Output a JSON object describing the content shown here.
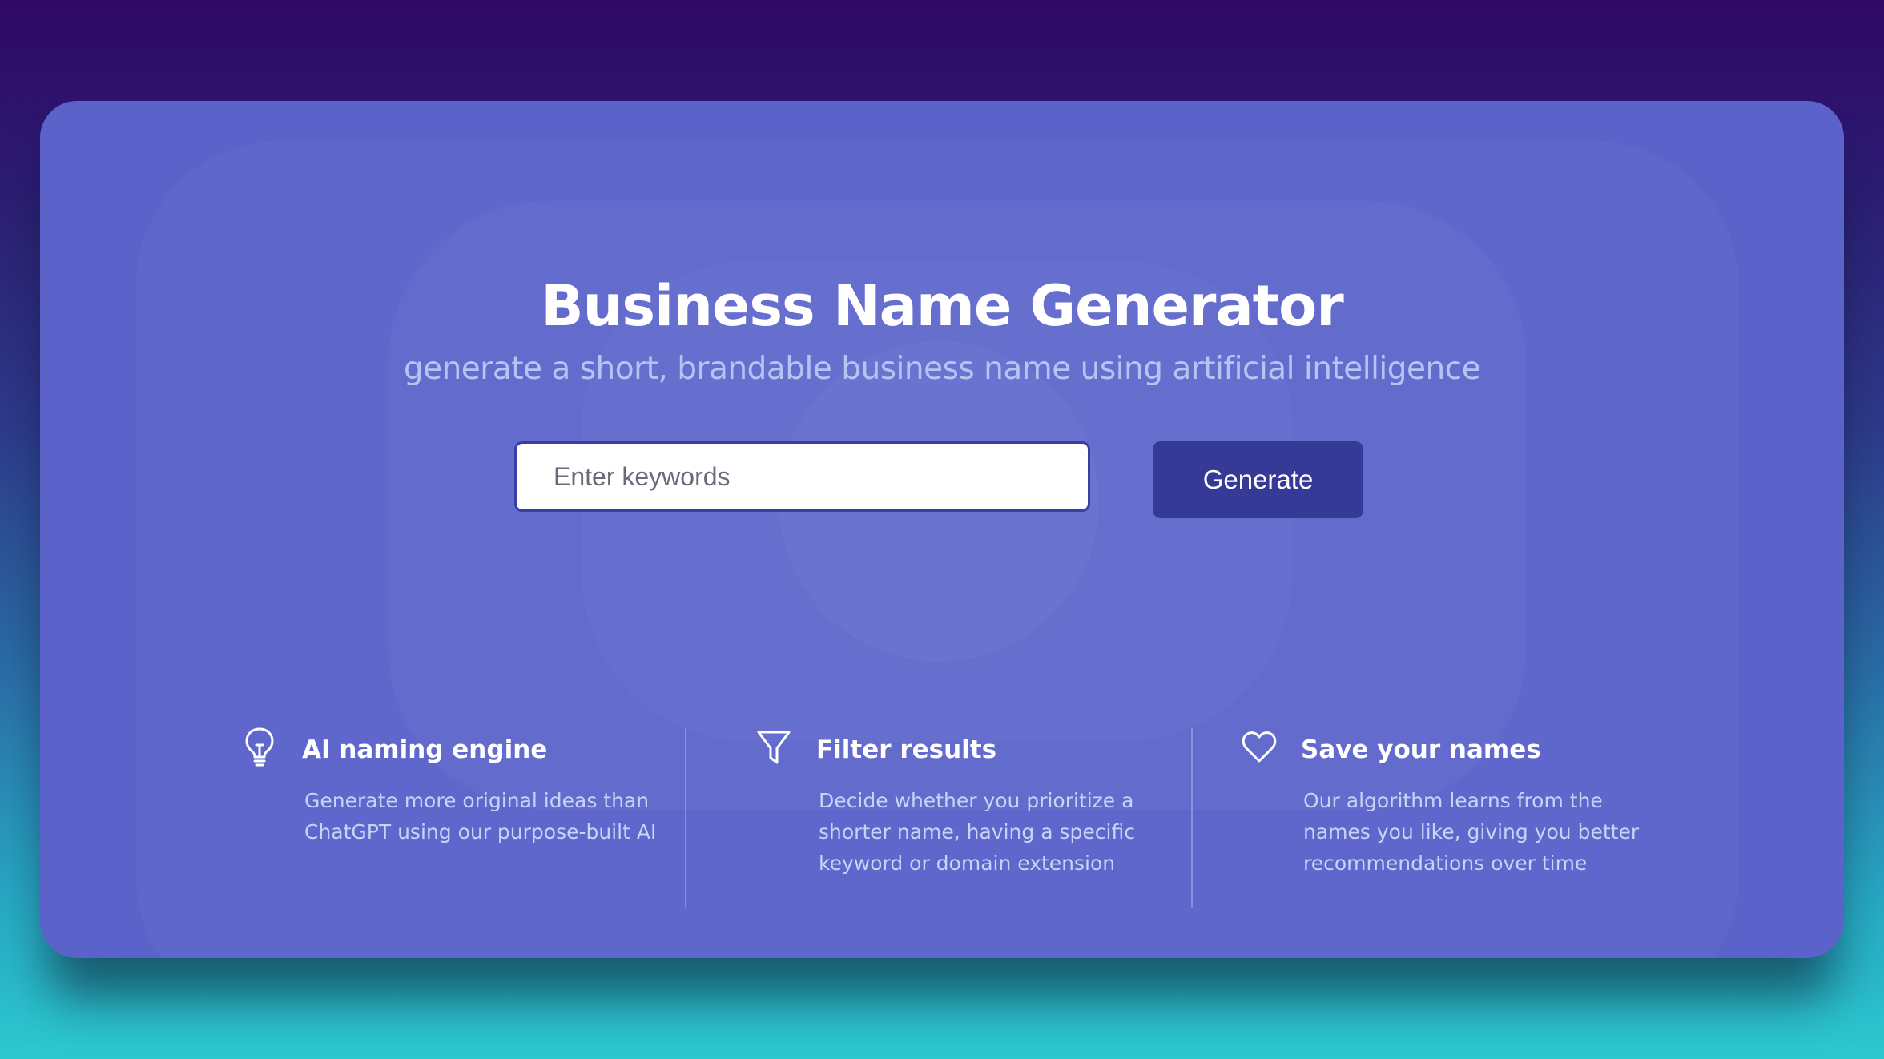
{
  "hero": {
    "title": "Business Name Generator",
    "subtitle": "generate a short, brandable business name using artificial intelligence"
  },
  "search": {
    "placeholder": "Enter keywords",
    "value": "",
    "button_label": "Generate"
  },
  "features": [
    {
      "icon": "lightbulb-icon",
      "title": "AI naming engine",
      "description": "Generate more original ideas than ChatGPT using our purpose-built AI"
    },
    {
      "icon": "filter-icon",
      "title": "Filter results",
      "description": "Decide whether you prioritize a shorter name, having a specific keyword or domain extension"
    },
    {
      "icon": "heart-icon",
      "title": "Save your names",
      "description": "Our algorithm learns from the names you like, giving you better recommendations over time"
    }
  ],
  "colors": {
    "card_background": "#5b63cb",
    "button_background": "#353a96",
    "subtitle_text": "#b2c6f4",
    "feature_text": "#c9d3f6"
  }
}
